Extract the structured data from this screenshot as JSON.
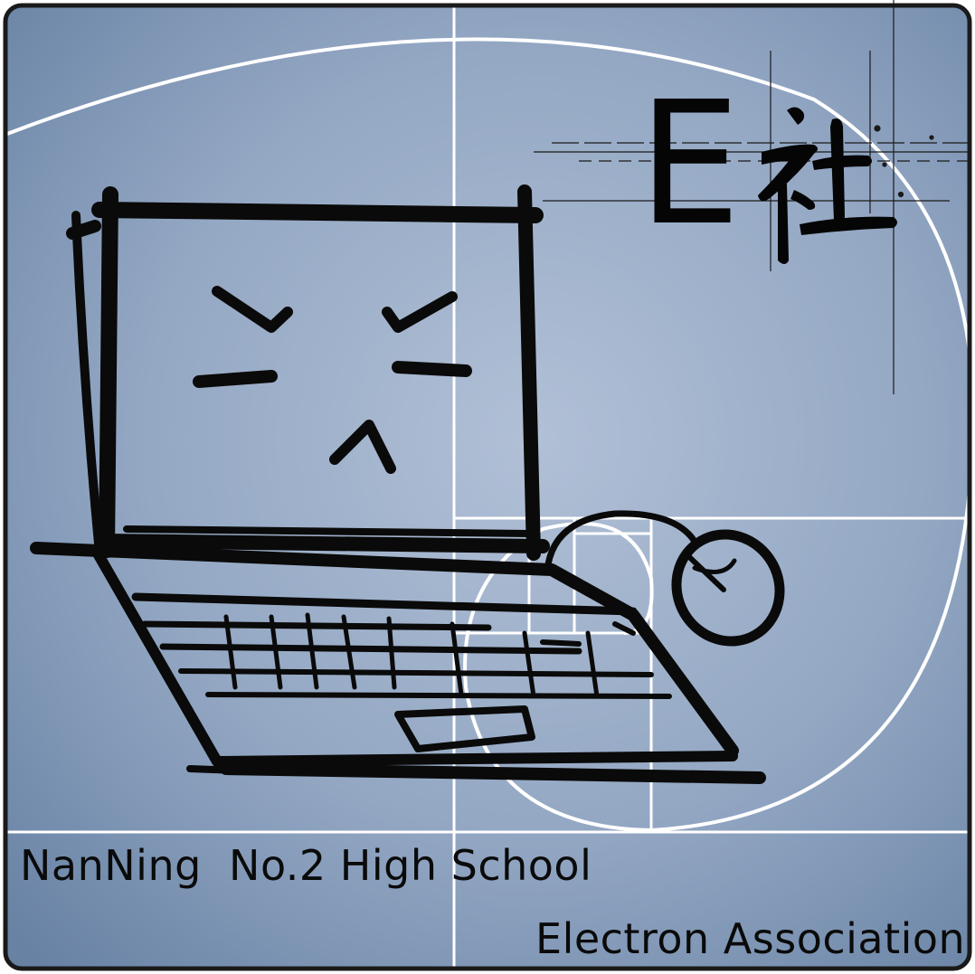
{
  "brand": {
    "mark_latin": "E",
    "mark_cjk": "社",
    "school_name": "NanNing  No.2 High School",
    "association_name": "Electron Association"
  },
  "colors": {
    "background_center": "#a9b9d1",
    "background_edge": "#6c84a5",
    "frame": "#1a1a1a",
    "guide_lines": "#ffffff",
    "ink": "#0a0a0a"
  },
  "icons": {
    "main_illustration": "angry-laptop-sketch-icon",
    "peripheral": "computer-mouse-icon"
  }
}
